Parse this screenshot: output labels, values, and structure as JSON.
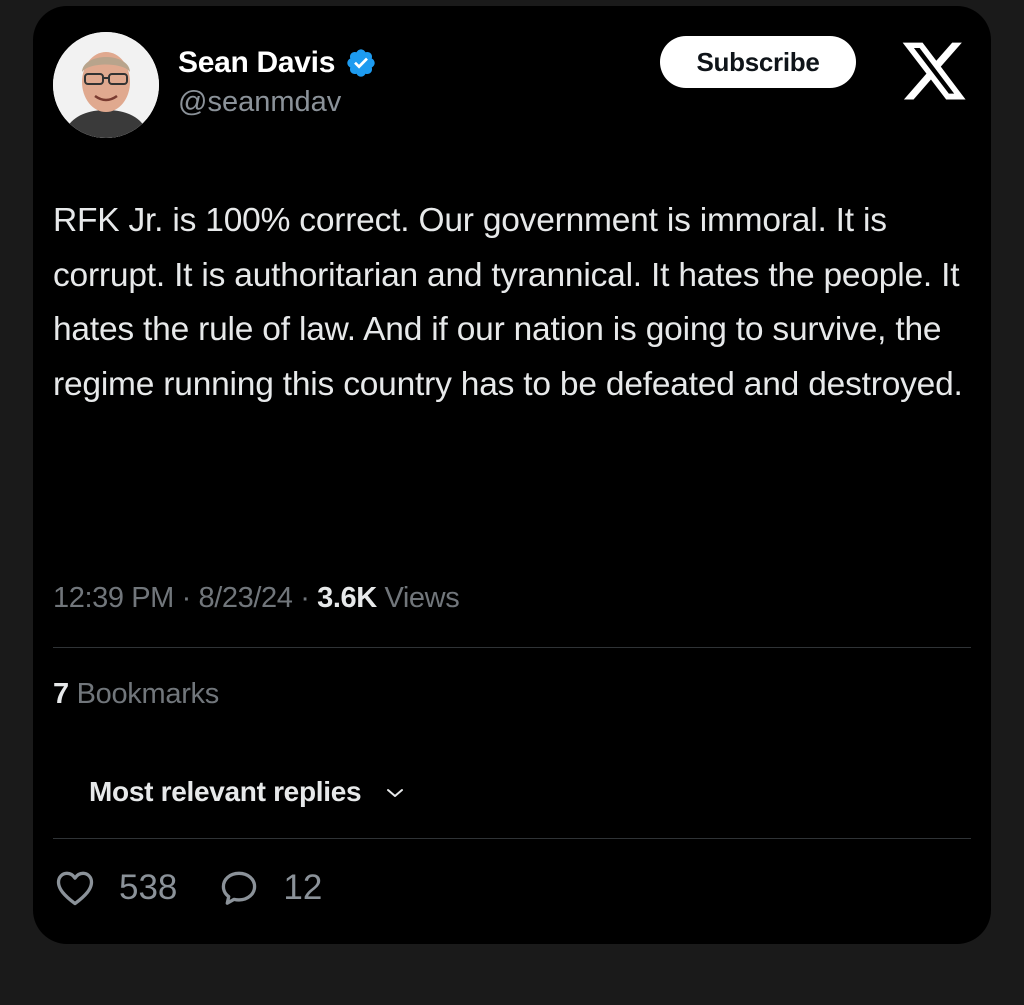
{
  "author": {
    "name": "Sean Davis",
    "handle": "@seanmdav",
    "verified_color": "#1d9bf0"
  },
  "header": {
    "subscribe_label": "Subscribe",
    "logo": "x-logo"
  },
  "tweet": {
    "text": "RFK Jr. is 100% correct. Our government is immoral. It is corrupt. It is authoritarian and tyrannical. It hates the people. It hates the rule of law. And if our nation is going to survive, the regime running this country has to be defeated and destroyed.",
    "time": "12:39 PM",
    "date": "8/23/24",
    "separator": "·",
    "views_count": "3.6K",
    "views_label": "Views"
  },
  "bookmarks": {
    "count": "7",
    "label": "Bookmarks"
  },
  "replies": {
    "sort_label": "Most relevant replies"
  },
  "actions": {
    "likes": "538",
    "replies": "12"
  },
  "icons": [
    "verified-badge-icon",
    "x-logo-icon",
    "chevron-down-icon",
    "heart-icon",
    "reply-bubble-icon"
  ]
}
